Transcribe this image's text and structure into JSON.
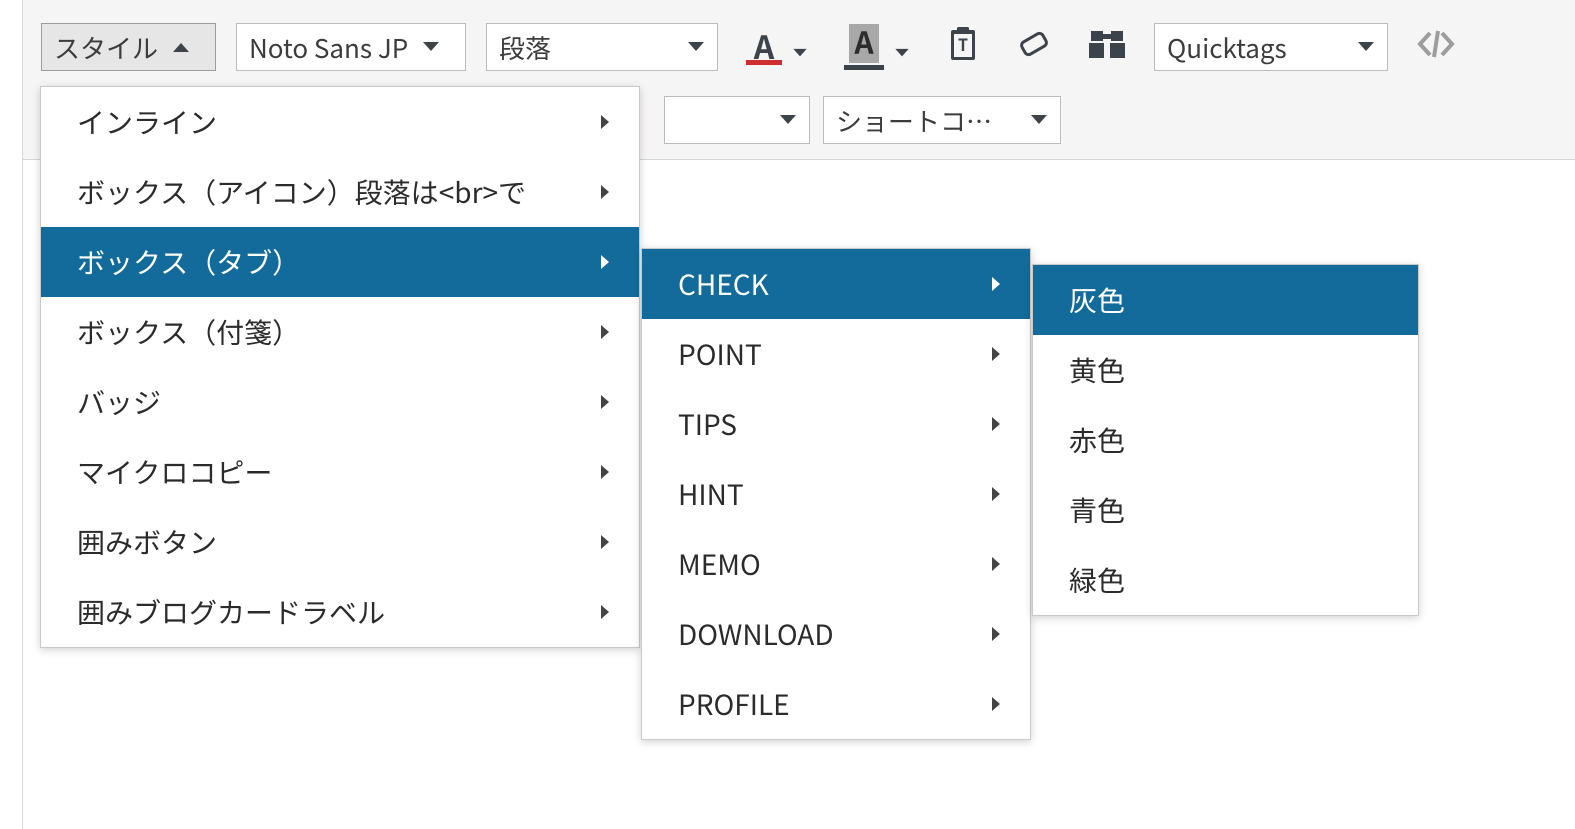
{
  "toolbar": {
    "style_dd_label": "スタイル",
    "font_dd_label": "Noto Sans JP",
    "format_dd_label": "段落",
    "quicktags_dd_label": "Quicktags",
    "row2_hidden_dd_label": "",
    "row2_shortcode_dd_label": "ショートコ…"
  },
  "menu_style": {
    "items": [
      {
        "label": "インライン"
      },
      {
        "label": "ボックス（アイコン）段落は<br>で"
      },
      {
        "label": "ボックス（タブ）"
      },
      {
        "label": "ボックス（付箋）"
      },
      {
        "label": "バッジ"
      },
      {
        "label": "マイクロコピー"
      },
      {
        "label": "囲みボタン"
      },
      {
        "label": "囲みブログカードラベル"
      }
    ],
    "selected_index": 2
  },
  "menu_box_tab": {
    "items": [
      {
        "label": "CHECK"
      },
      {
        "label": "POINT"
      },
      {
        "label": "TIPS"
      },
      {
        "label": "HINT"
      },
      {
        "label": "MEMO"
      },
      {
        "label": "DOWNLOAD"
      },
      {
        "label": "PROFILE"
      }
    ],
    "selected_index": 0
  },
  "menu_colors": {
    "items": [
      {
        "label": "灰色"
      },
      {
        "label": "黄色"
      },
      {
        "label": "赤色"
      },
      {
        "label": "青色"
      },
      {
        "label": "緑色"
      }
    ],
    "selected_index": 0
  }
}
